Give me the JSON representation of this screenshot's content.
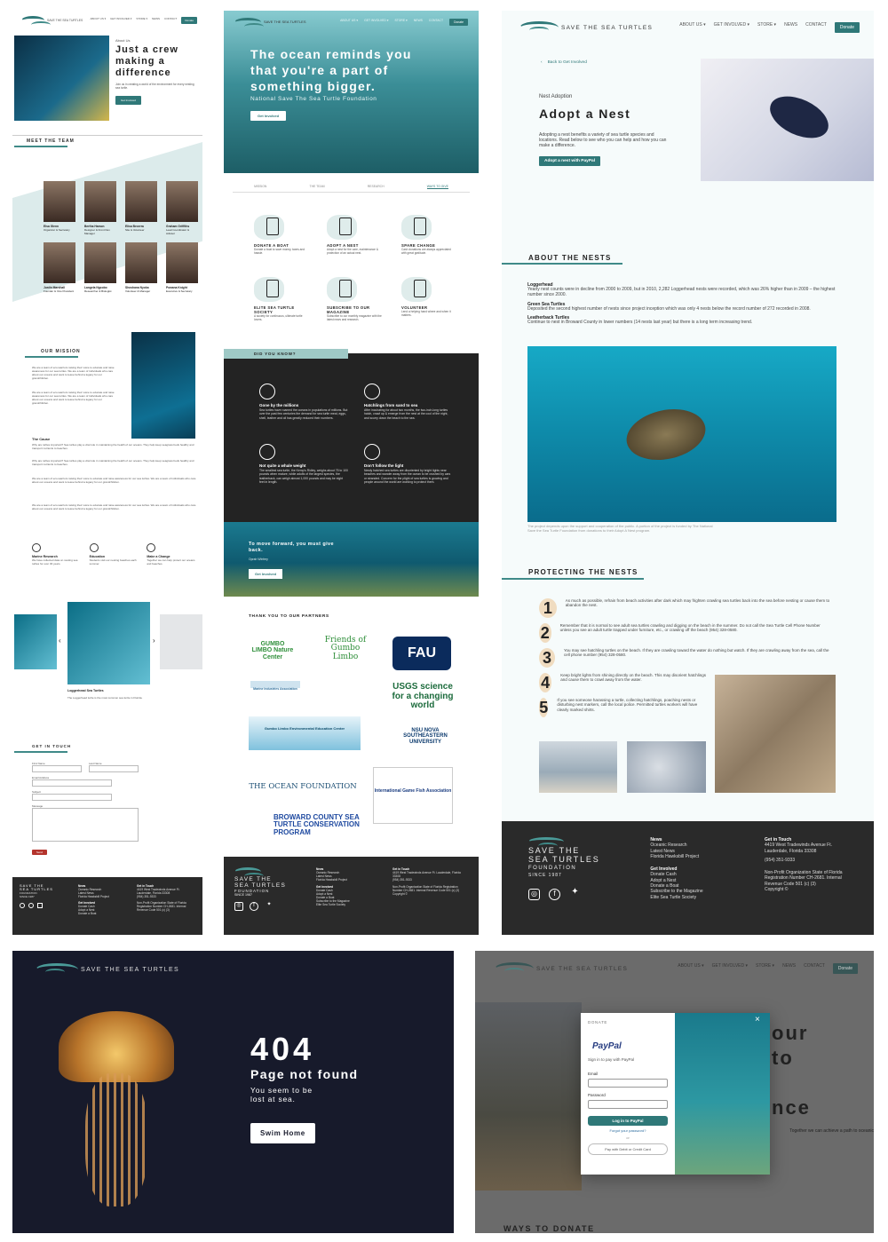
{
  "logo": {
    "text": "SAVE THE SEA TURTLES",
    "footer_line1": "SAVE THE",
    "footer_line2": "SEA TURTLES",
    "footer_line3": "FOUNDATION",
    "footer_line4": "SINCE 1987"
  },
  "nav": {
    "about": "ABOUT US ▾",
    "involved": "GET INVOLVED ▾",
    "store": "STORE ▾",
    "news": "NEWS",
    "contact": "CONTACT",
    "donate": "Donate"
  },
  "about_page": {
    "kicker": "About Us",
    "title": "Just a crew making a difference",
    "intro": "Join us in creating a world of the environment for every nesting sea turtle.",
    "cta": "Get Involved",
    "team_title": "MEET THE TEAM",
    "team": [
      {
        "name": "Elsa Glenn",
        "role": "Organizer & Secretary"
      },
      {
        "name": "Bertha Hamon",
        "role": "Designer & Front Dev Manager"
      },
      {
        "name": "Elisa Becerra",
        "role": "Site & Volunteer"
      },
      {
        "name": "Graham Griffiths",
        "role": "Lead Coordinator & Advisor"
      },
      {
        "name": "Justin Marshall",
        "role": "Founder & Vice President"
      },
      {
        "name": "Langela Ngcobo",
        "role": "Researcher & Biologist"
      },
      {
        "name": "Shoshana Nyoka",
        "role": "Volunteer & Manager"
      },
      {
        "name": "Powana Knight",
        "role": "Executive & Secretary"
      }
    ],
    "mission_title": "OUR MISSION",
    "mission_text": "We are a team of eco-warriors raising their voice to educate and raise awareness for our sea turtles. We are a team of individuals who care about our oceans and want to leave behind a legacy for our grandchildren.",
    "cause_title": "The Cause",
    "cause_text": "Why are turtles important? Sea turtles play a vital role in maintaining the health of our oceans. They help keep seagrass beds healthy and transport nutrients to beaches.",
    "pillars": [
      {
        "title": "Marine Research",
        "text": "We have collected data on nesting sea turtles for over 30 years."
      },
      {
        "title": "Education",
        "text": "Students visit our nesting beaches each summer."
      },
      {
        "title": "Make a Change",
        "text": "Together we can help protect our oceans and beaches."
      }
    ],
    "slider_caption_title": "Loggerhead Sea Turtles",
    "slider_caption": "The Loggerhead turtle is the most common sea turtle in Florida.",
    "contact_title": "GET IN TOUCH",
    "first": "First Name",
    "last": "Last Name",
    "email": "Email Address",
    "subject": "Subject",
    "message": "Message",
    "send": "Send"
  },
  "home_page": {
    "hero_title": "The ocean reminds you that you're a part of something bigger.",
    "hero_sub": "National Save The Sea Turtle Foundation",
    "hero_cta": "Get Involved",
    "tabs": [
      "MISSION",
      "THE TEAM",
      "RESEARCH",
      "WAYS TO GIVE"
    ],
    "ways": [
      {
        "title": "DONATE A BOAT",
        "text": "Donate a boat to save money, taxes and hassle."
      },
      {
        "title": "ADOPT A NEST",
        "text": "Adopt a nest for the care, maintenance & protection of an actual nest."
      },
      {
        "title": "SPARE CHANGE",
        "text": "Cash donations are always appreciated with great gratitude."
      },
      {
        "title": "ELITE SEA TURTLE SOCIETY",
        "text": "A society for continuous, ultimate turtle lovers."
      },
      {
        "title": "SUBSCRIBE TO OUR MAGAZINE",
        "text": "Subscribe to our monthly magazine with the latest news and research."
      },
      {
        "title": "VOLUNTEER",
        "text": "Lend a helping hand where and when it matters."
      }
    ],
    "dyk_title": "DID YOU KNOW?",
    "facts": [
      {
        "title": "Gone by the millions",
        "text": "Sea turtles have roamed the oceans in populations of millions. But over the past few centuries the demand for sea turtle meat, eggs, shell, leather and oil has greatly reduced their numbers."
      },
      {
        "title": "Hatchlings from sand to sea",
        "text": "After incubating for about two months, the two-inch-long turtles hatch, crawl up & emerge from the nest at the cool of the night, and scurry down the beach to the sea."
      },
      {
        "title": "Not quite a whale weight",
        "text": "The smallest sea turtle, the Kemp's Ridley, weighs about 75 to 100 pounds when mature, while adults of the largest species, the leatherback, can weigh almost 1,000 pounds and may be eight feet in length."
      },
      {
        "title": "Don't follow the light",
        "text": "Newly hatched sea turtles are disoriented by bright lights near beaches and wander away from the ocean to be crushed by cars or stranded. Concern for the plight of sea turtles is growing and people around the world are working to protect them."
      }
    ],
    "quote": "To move forward, you must give back.",
    "quote_author": "Oprah Winfrey",
    "quote_cta": "Get Involved",
    "partners_title": "THANK YOU TO OUR PARTNERS",
    "partners": [
      "GUMBO LIMBO Nature Center",
      "Friends of Gumbo Limbo",
      "FAU",
      "USGS science for a changing world",
      "Marine Industries Association",
      "Gumbo Limbo Environmental Education Center",
      "NSU NOVA SOUTHEASTERN UNIVERSITY",
      "THE OCEAN FOUNDATION",
      "BROWARD COUNTY SEA TURTLE CONSERVATION PROGRAM",
      "International Game Fish Association"
    ]
  },
  "adopt_page": {
    "back": "Back to Get Involved",
    "kicker": "Nest Adoption",
    "title": "Adopt a Nest",
    "intro": "Adopting a nest benefits a variety of sea turtle species and locations. Read below to see who you can help and how you can make a difference.",
    "cta": "Adopt a nest with PayPal",
    "about_title": "ABOUT THE NESTS",
    "nests": [
      {
        "name": "Loggerhead",
        "text": "Yearly nest counts were in decline from 2000 to 2009, but in 2010, 2,282 Loggerhead nests were recorded, which was 26% higher than in 2009 – the highest number since 2000."
      },
      {
        "name": "Green Sea Turtles",
        "text": "Deposited the second highest number of nests since project inception which was only 4 nests below the record number of 272 recorded in 2008."
      },
      {
        "name": "Leatherback Turtles",
        "text": "Continue to nest in Broward County in lower numbers (14 nests last year) but there is a long term increasing trend."
      }
    ],
    "photo_caption": "The project depends upon the support and cooperation of the public. A portion of the project is funded by The National Save the Sea Turtle Foundation from donations to their Adopt A Nest program.",
    "protect_title": "PROTECTING THE NESTS",
    "steps": [
      {
        "n": "1",
        "text": "As much as possible, refrain from beach activities after dark which may frighten crawling sea turtles back into the sea before nesting or cause them to abandon the nest."
      },
      {
        "n": "2",
        "text": "Remember that it is normal to see adult sea turtles crawling and digging on the beach in the summer. Do not call the Sea Turtle Cell Phone Number unless you see an adult turtle trapped under furniture, etc., or crawling off the beach (954) 328-0580."
      },
      {
        "n": "3",
        "text": "You may see hatchling turtles on the beach. If they are crawling toward the water do nothing but watch. If they are crawling away from the sea, call the cell phone number (954) 328-0580."
      },
      {
        "n": "4",
        "text": "Keep bright lights from shining directly on the beach. This may disorient hatchlings and cause them to crawl away from the water."
      },
      {
        "n": "5",
        "text": "If you see someone harassing a turtle, collecting hatchlings, poaching nests or disturbing nest markers, call the local police. Permitted turtles workers will have clearly marked shirts."
      }
    ]
  },
  "footer": {
    "news_title": "News",
    "news_items": [
      "Oceanic Research",
      "Latest News",
      "Florida Hawksbill Project"
    ],
    "involved_title": "Get Involved",
    "involved_items": [
      "Donate Cash",
      "Adopt a Nest",
      "Donate a Boat",
      "Subscribe to the Magazine",
      "Elite Sea Turtle Society"
    ],
    "touch_title": "Get in Touch",
    "address": "4419 West Tradewinds Avenue Ft. Lauderdale, Florida 33308",
    "phone": "(954) 351-9333",
    "legal": "Non-Profit Organization State of Florida Registration Number CH-2681. Internal Revenue Code 501 (c) (3)",
    "copyright": "Copyright ©"
  },
  "notfound": {
    "code": "404",
    "title": "Page not found",
    "text": "You seem to be lost at sea.",
    "cta": "Swim Home"
  },
  "donate_popup": {
    "header": "DONATE",
    "brand": "PayPal",
    "signin": "Sign in to pay with PayPal",
    "email": "Email",
    "password": "Password",
    "login": "Log in to PayPal",
    "forgot": "Forgot your password?",
    "or": "or",
    "card": "Pay with Debit or Credit Card",
    "bg_heading": "WAYS TO DONATE",
    "bg_partial1": "our",
    "bg_partial2": "to",
    "bg_partial3": "nce",
    "bg_partial_text": "Together we can achieve a path to oceanic"
  },
  "colors": {
    "accent": "#2f7878",
    "dark": "#232323",
    "navy": "#171a2b"
  }
}
